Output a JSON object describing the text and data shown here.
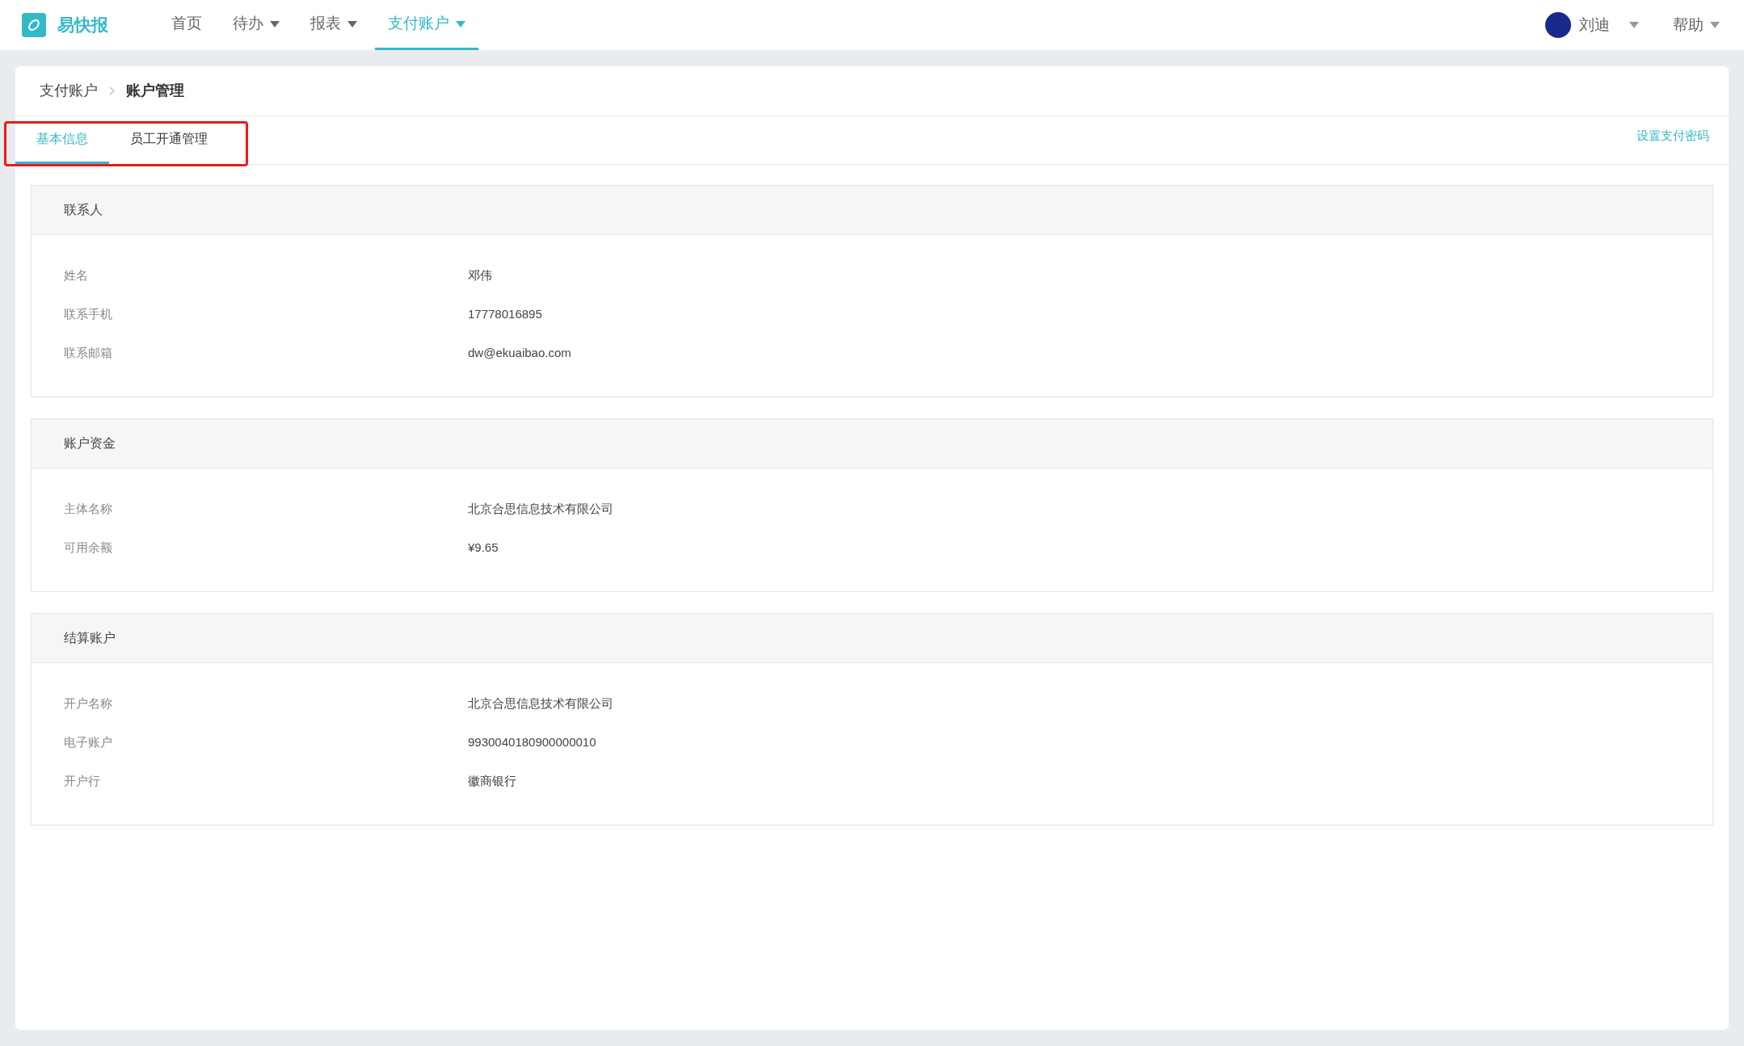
{
  "header": {
    "logo_text": "易快报",
    "nav": [
      {
        "label": "首页",
        "selected": false,
        "dropdown": false
      },
      {
        "label": "待办",
        "selected": false,
        "dropdown": true
      },
      {
        "label": "报表",
        "selected": false,
        "dropdown": true
      },
      {
        "label": "支付账户",
        "selected": true,
        "dropdown": true
      }
    ],
    "user": {
      "name": "刘迪"
    },
    "help": "帮助"
  },
  "breadcrumb": [
    "支付账户",
    "账户管理"
  ],
  "tabs": [
    {
      "label": "基本信息",
      "selected": true
    },
    {
      "label": "员工开通管理",
      "selected": false
    }
  ],
  "set_password_link": "设置支付密码",
  "sections": [
    {
      "title": "联系人",
      "fields": [
        {
          "label": "姓名",
          "value": "邓伟"
        },
        {
          "label": "联系手机",
          "value": "17778016895"
        },
        {
          "label": "联系邮箱",
          "value": "dw@ekuaibao.com"
        }
      ]
    },
    {
      "title": "账户资金",
      "fields": [
        {
          "label": "主体名称",
          "value": "北京合思信息技术有限公司"
        },
        {
          "label": "可用余额",
          "value": "¥9.65"
        }
      ]
    },
    {
      "title": "结算账户",
      "fields": [
        {
          "label": "开户名称",
          "value": "北京合思信息技术有限公司"
        },
        {
          "label": "电子账户",
          "value": "9930040180900000010"
        },
        {
          "label": "开户行",
          "value": "徽商银行"
        }
      ]
    }
  ]
}
